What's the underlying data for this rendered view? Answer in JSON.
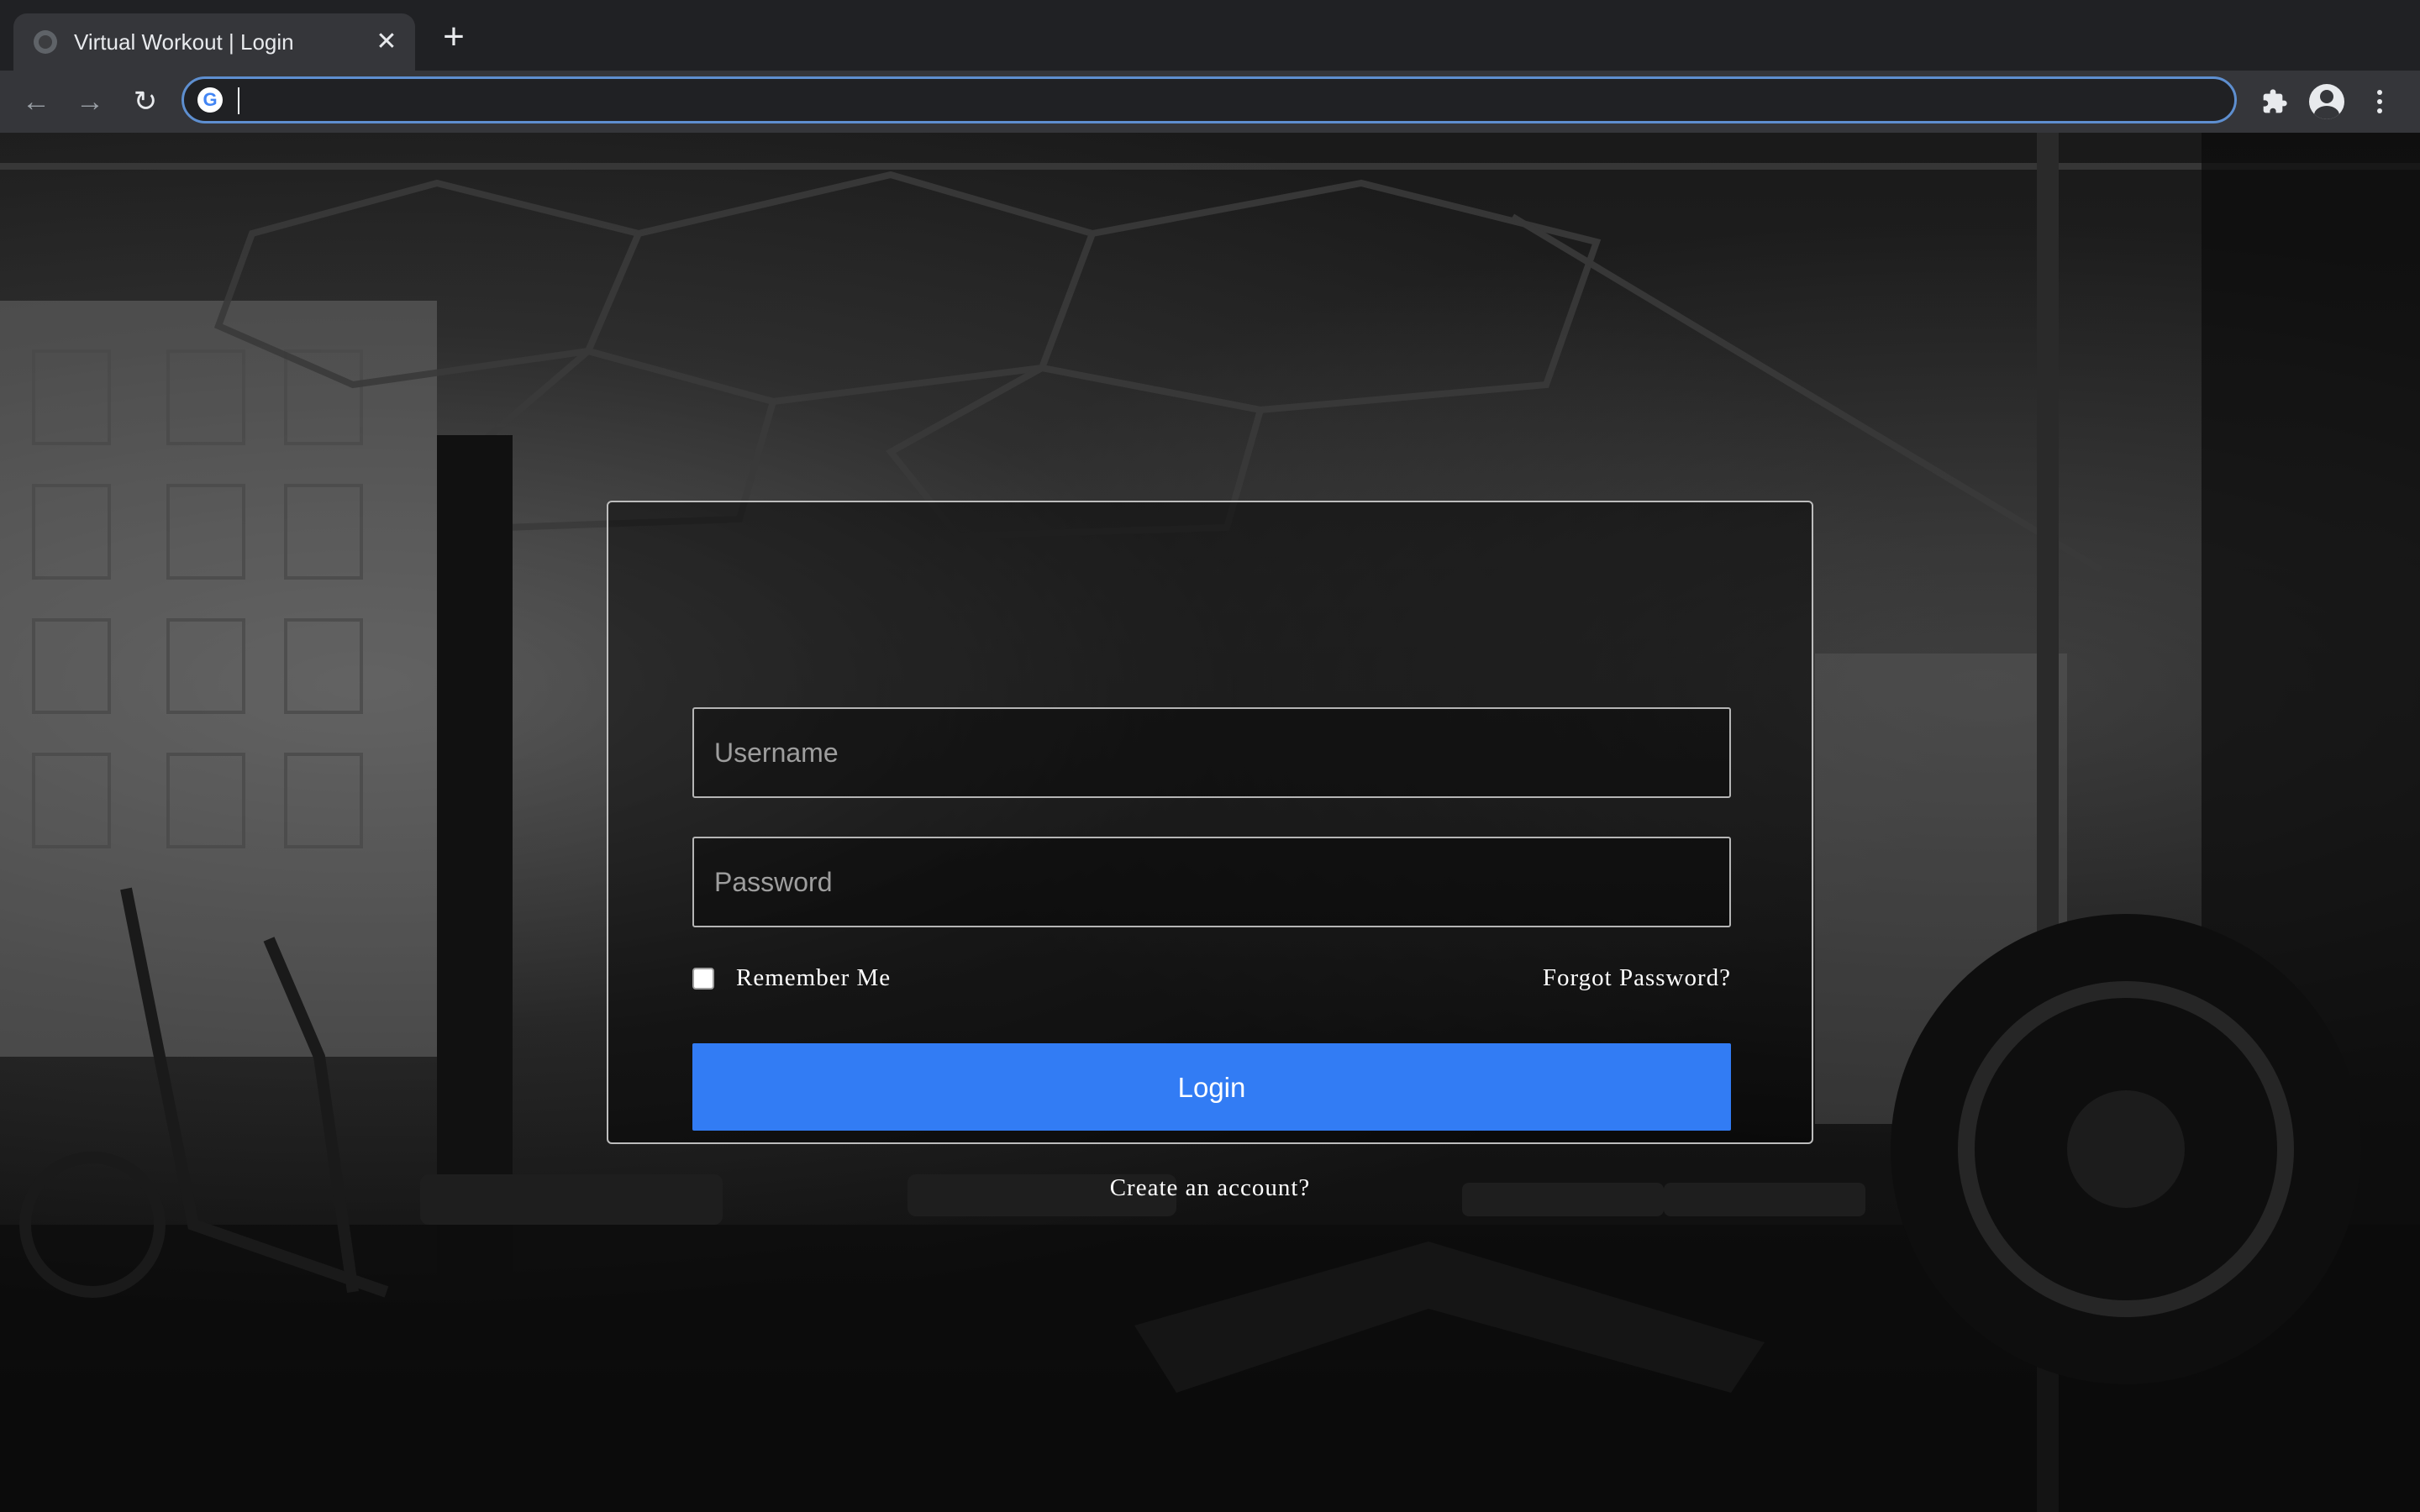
{
  "browser": {
    "tab_title": "Virtual Workout | Login",
    "tab_close_icon": "close-icon",
    "new_tab_icon": "plus-icon",
    "address_value": "",
    "back_icon": "arrow-left-icon",
    "forward_icon": "arrow-right-icon",
    "reload_icon": "reload-icon",
    "extensions_icon": "puzzle-icon",
    "profile_icon": "account-icon",
    "menu_icon": "more-vert-icon"
  },
  "login": {
    "username_placeholder": "Username",
    "password_placeholder": "Password",
    "remember_label": "Remember Me",
    "remember_checked": false,
    "forgot_label": "Forgot Password?",
    "login_label": "Login",
    "create_label": "Create an account?"
  },
  "colors": {
    "accent": "#327cf4",
    "chrome_dark": "#202124",
    "chrome_toolbar": "#35363a",
    "card_border": "#bdbdbd"
  }
}
